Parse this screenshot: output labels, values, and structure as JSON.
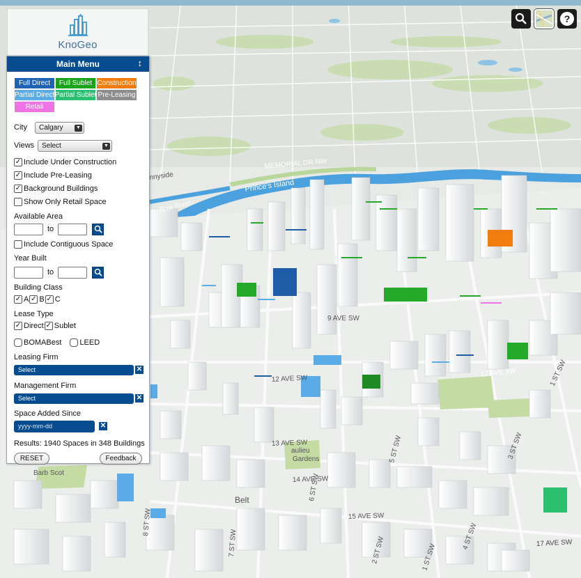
{
  "logo": {
    "name": "KnoGeo"
  },
  "map_controls": {
    "search_icon": "search-icon",
    "basemap_icon": "basemap-icon",
    "help_icon": "help-icon"
  },
  "map_labels": {
    "memorial_dr": "MEMORIAL DR NW",
    "princes_island": "Prince's Island",
    "bow_river": "Bow River",
    "sunnyside": "nnyside",
    "ave9": "9 AVE SW",
    "ave12": "12 AVE SW",
    "ave12b": "12 AVE SW",
    "ave13": "13 AVE SW",
    "ave14": "14 AVE SW",
    "ave15": "15 AVE SW",
    "ave17": "17 AVE SW",
    "gardens": "Gardens",
    "beaulieu": "aulieu",
    "belt": "Belt",
    "st8": "8 ST SW",
    "st7": "7 ST SW",
    "st6": "6 ST SW",
    "st5": "5 ST SW",
    "st4": "4 ST SW",
    "st1": "1 ST SW",
    "st1b": "1 ST SW",
    "st2": "2 ST SW",
    "st3": "3 ST SW",
    "park": "Barb Scot"
  },
  "menu": {
    "title": "Main Menu",
    "resize_icon": "resize-vertical-icon",
    "legend": [
      {
        "label": "Full Direct",
        "color": "#1f63b4"
      },
      {
        "label": "Full Sublet",
        "color": "#1ba31b"
      },
      {
        "label": "Construction",
        "color": "#f07d0d"
      },
      {
        "label": "Partial Direct",
        "color": "#5aabe6"
      },
      {
        "label": "Partial Sublet",
        "color": "#2bc070"
      },
      {
        "label": "Pre-Leasing",
        "color": "#8d8d8d"
      },
      {
        "label": "Retail",
        "color": "#ee74e6"
      }
    ],
    "city_label": "City",
    "city_value": "Calgary",
    "views_label": "Views",
    "views_value": "Select",
    "checks": {
      "under_construction": "Include Under Construction",
      "pre_leasing": "Include Pre-Leasing",
      "background_buildings": "Background Buildings",
      "retail_only": "Show Only Retail Space"
    },
    "available_area_label": "Available Area",
    "to_label": "to",
    "contiguous_label": "Include Contiguous Space",
    "year_built_label": "Year Built",
    "to_label_2": "to",
    "building_class_label": "Building Class",
    "class_a": "A",
    "class_b": "B",
    "class_c": "C",
    "lease_type_label": "Lease Type",
    "direct_label": "Direct",
    "sublet_label": "Sublet",
    "boma_label": "BOMABest",
    "leed_label": "LEED",
    "leasing_firm_label": "Leasing Firm",
    "leasing_firm_value": "Select",
    "management_firm_label": "Management Firm",
    "management_firm_value": "Select",
    "space_added_label": "Space Added Since",
    "space_added_placeholder": "yyyy-mm-dd",
    "results": "Results: 1940 Spaces in 348 Buildings",
    "reset_label": "RESET",
    "feedback_label": "Feedback"
  }
}
